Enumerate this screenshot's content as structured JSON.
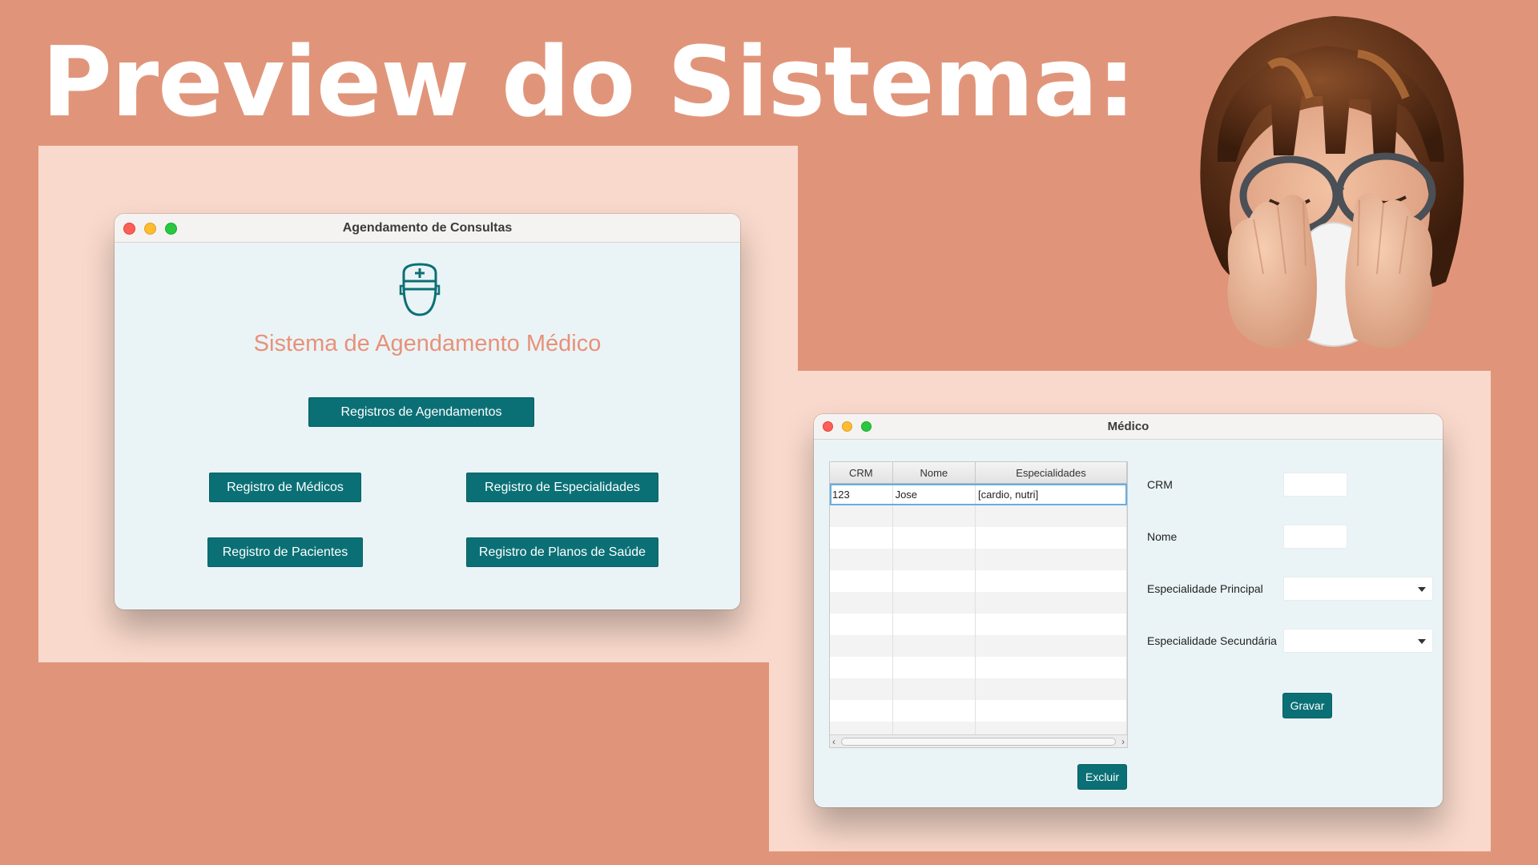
{
  "headline": "Preview do Sistema:",
  "colors": {
    "background": "#e0957a",
    "panel": "#f9d9cb",
    "accent_teal": "#0b7076",
    "title_coral": "#e8917a"
  },
  "main_window": {
    "title": "Agendamento de Consultas",
    "icon": "doctor-icon",
    "app_title": "Sistema de Agendamento Médico",
    "buttons": {
      "agendamentos": "Registros de Agendamentos",
      "medicos": "Registro de Médicos",
      "especialidades": "Registro de Especialidades",
      "pacientes": "Registro de Pacientes",
      "planos": "Registro de Planos de Saúde"
    }
  },
  "medico_window": {
    "title": "Médico",
    "table": {
      "columns": [
        "CRM",
        "Nome",
        "Especialidades"
      ],
      "rows": [
        {
          "crm": "123",
          "nome": "Jose",
          "especialidades": "[cardio, nutri]"
        }
      ]
    },
    "form": {
      "crm_label": "CRM",
      "crm_value": "",
      "nome_label": "Nome",
      "nome_value": "",
      "esp_principal_label": "Especialidade Principal",
      "esp_principal_value": "",
      "esp_secundaria_label": "Especialidade Secundária",
      "esp_secundaria_value": ""
    },
    "buttons": {
      "gravar": "Gravar",
      "excluir": "Excluir"
    }
  },
  "decoration": {
    "memoji": "sneezing-woman-memoji"
  }
}
